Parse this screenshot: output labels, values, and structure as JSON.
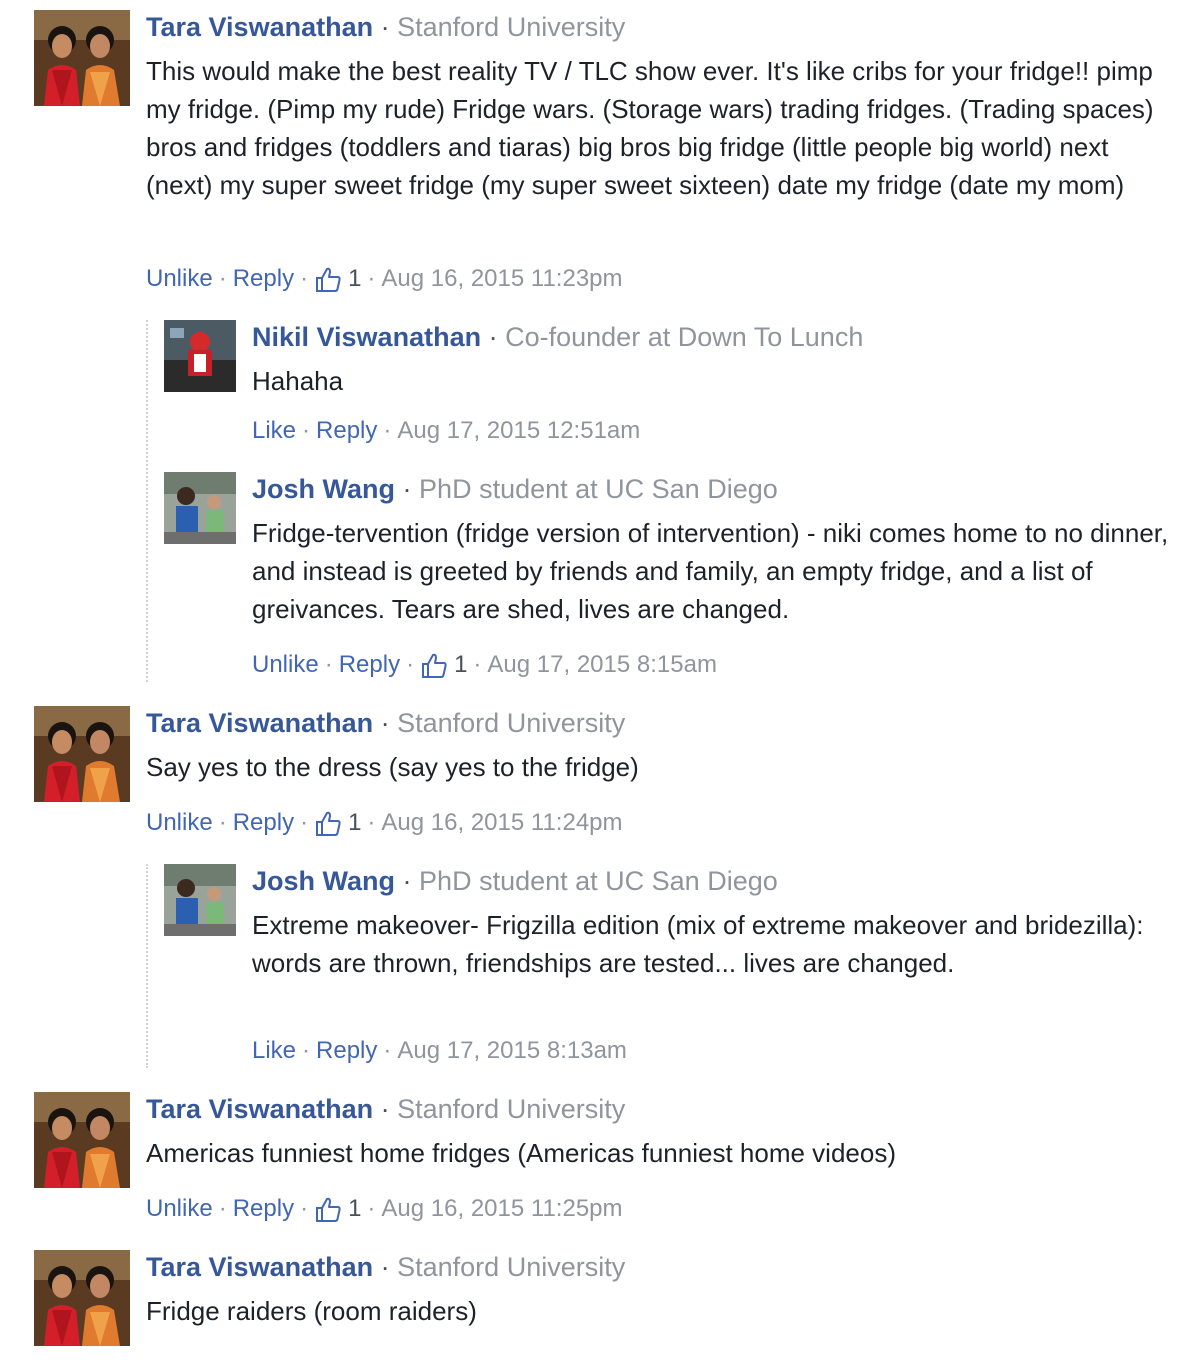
{
  "comments": [
    {
      "author": "Tara Viswanathan",
      "affiliation": "Stanford University",
      "text": "This would make the best reality TV / TLC show ever. It's like cribs for your fridge!! pimp my fridge. (Pimp my rude) Fridge wars. (Storage wars) trading fridges. (Trading spaces) bros and fridges (toddlers and tiaras) big bros big fridge (little people big world) next (next) my super sweet fridge (my super sweet sixteen) date my fridge (date my mom)",
      "like_action": "Unlike",
      "reply_action": "Reply",
      "like_count": "1",
      "timestamp": "Aug 16, 2015 11:23pm",
      "replies": [
        {
          "author": "Nikil Viswanathan",
          "affiliation": "Co-founder at Down To Lunch",
          "text": "Hahaha",
          "like_action": "Like",
          "reply_action": "Reply",
          "timestamp": "Aug 17, 2015 12:51am"
        },
        {
          "author": "Josh Wang",
          "affiliation": "PhD student at UC San Diego",
          "text": "Fridge-tervention (fridge version of intervention) - niki comes home to no dinner, and instead is greeted by friends and family, an empty fridge, and a list of greivances. Tears are shed, lives are changed.",
          "like_action": "Unlike",
          "reply_action": "Reply",
          "like_count": "1",
          "timestamp": "Aug 17, 2015 8:15am"
        }
      ]
    },
    {
      "author": "Tara Viswanathan",
      "affiliation": "Stanford University",
      "text": "Say yes to the dress (say yes to the fridge)",
      "like_action": "Unlike",
      "reply_action": "Reply",
      "like_count": "1",
      "timestamp": "Aug 16, 2015 11:24pm",
      "replies": [
        {
          "author": "Josh Wang",
          "affiliation": "PhD student at UC San Diego",
          "text": "Extreme makeover- Frigzilla edition (mix of extreme makeover and bridezilla): words are thrown, friendships are tested... lives are changed.",
          "like_action": "Like",
          "reply_action": "Reply",
          "timestamp": "Aug 17, 2015 8:13am"
        }
      ]
    },
    {
      "author": "Tara Viswanathan",
      "affiliation": "Stanford University",
      "text": "Americas funniest home fridges (Americas funniest home videos)",
      "like_action": "Unlike",
      "reply_action": "Reply",
      "like_count": "1",
      "timestamp": "Aug 16, 2015 11:25pm"
    },
    {
      "author": "Tara Viswanathan",
      "affiliation": "Stanford University",
      "text": "Fridge raiders (room raiders)"
    }
  ],
  "separator": "·",
  "colors": {
    "name": "#365899",
    "link": "#4267b2",
    "meta": "#90949c",
    "text": "#1d2129"
  }
}
